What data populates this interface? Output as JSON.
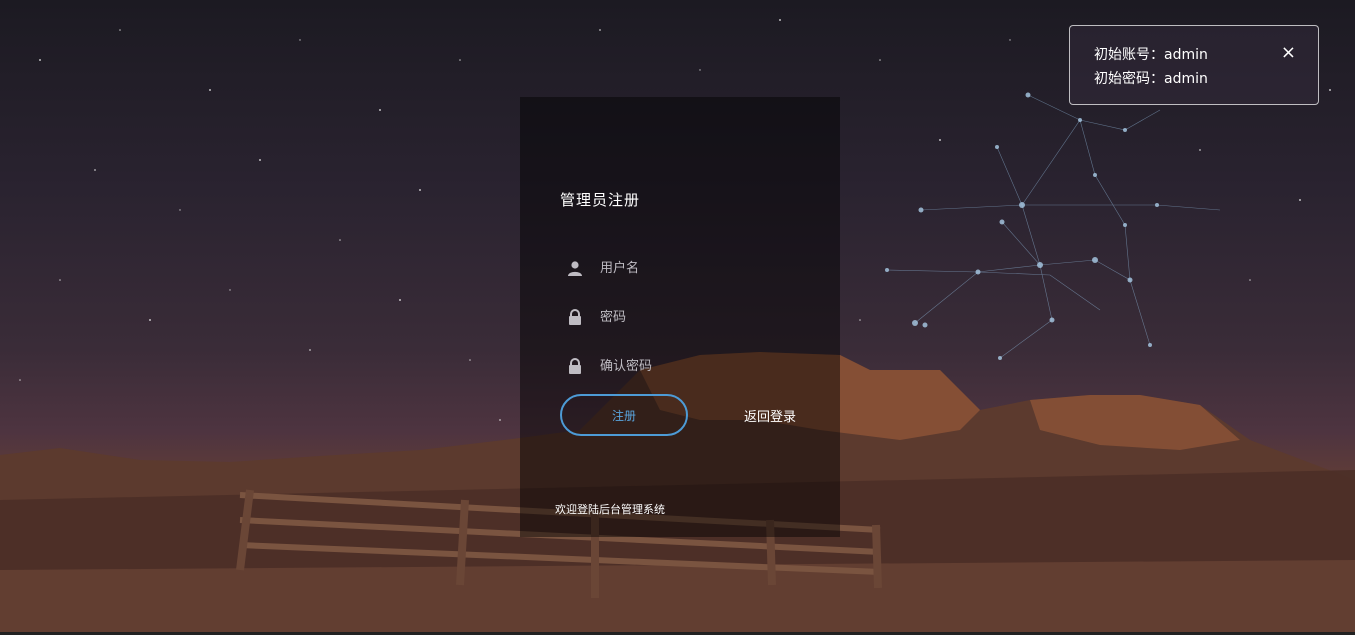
{
  "notice": {
    "line1": "初始账号：admin",
    "line2": "初始密码：admin",
    "close": "×"
  },
  "panel": {
    "title": "管理员注册",
    "username_placeholder": "用户名",
    "password_placeholder": "密码",
    "confirm_placeholder": "确认密码",
    "register_label": "注册",
    "back_label": "返回登录",
    "welcome": "欢迎登陆后台管理系统"
  },
  "icons": {
    "username": "user-icon",
    "password": "lock-icon",
    "confirm": "lock-icon"
  },
  "colors": {
    "accent": "#4d9bd6",
    "panel_bg": "rgba(0,0,0,0.45)",
    "text": "#ffffff"
  }
}
